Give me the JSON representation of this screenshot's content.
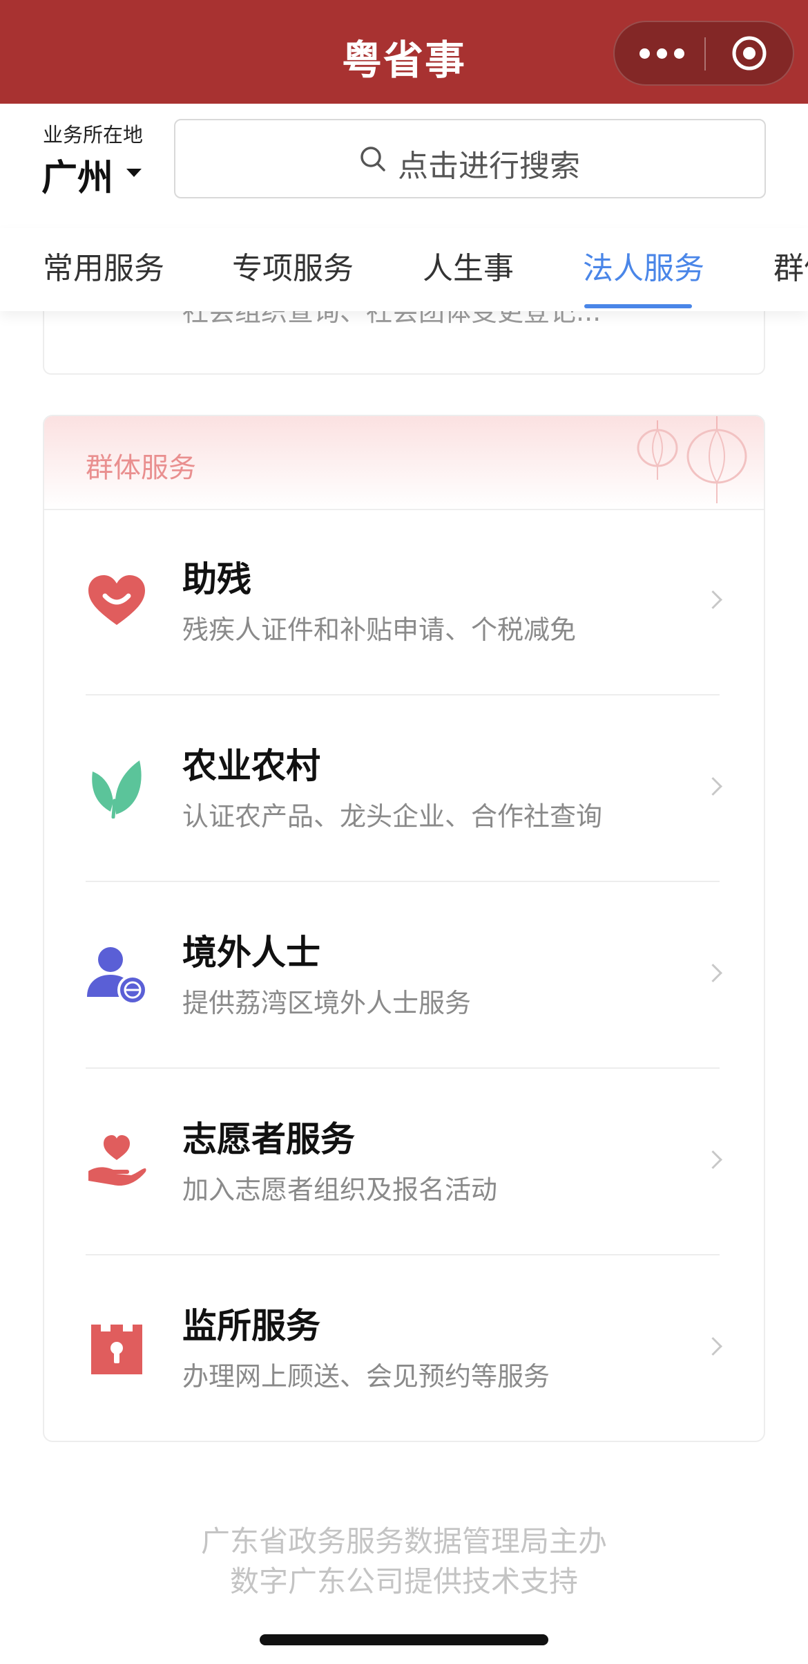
{
  "header": {
    "title": "粤省事",
    "background": "#a83231"
  },
  "location": {
    "label": "业务所在地",
    "city": "广州"
  },
  "search": {
    "placeholder": "点击进行搜索"
  },
  "tabs": [
    {
      "label": "常用服务",
      "active": false
    },
    {
      "label": "专项服务",
      "active": false
    },
    {
      "label": "人生事",
      "active": false
    },
    {
      "label": "法人服务",
      "active": true
    },
    {
      "label": "群体服务",
      "active": false
    }
  ],
  "accent_color": "#4a86e8",
  "previous_card": {
    "description": "社会组织查询、社会团体变更登记..."
  },
  "group_card": {
    "title": "群体服务",
    "items": [
      {
        "title": "助残",
        "description": "残疾人证件和补贴申请、个税减免",
        "icon": "heart-smile-icon",
        "icon_color": "#e05d5d"
      },
      {
        "title": "农业农村",
        "description": "认证农产品、龙头企业、合作社查询",
        "icon": "leaf-icon",
        "icon_color": "#5bc49a"
      },
      {
        "title": "境外人士",
        "description": "提供荔湾区境外人士服务",
        "icon": "person-globe-icon",
        "icon_color": "#5a5fd6"
      },
      {
        "title": "志愿者服务",
        "description": "加入志愿者组织及报名活动",
        "icon": "hand-heart-icon",
        "icon_color": "#e05d5d"
      },
      {
        "title": "监所服务",
        "description": "办理网上顾送、会见预约等服务",
        "icon": "prison-icon",
        "icon_color": "#e05d5d"
      }
    ]
  },
  "footer": {
    "line1": "广东省政务服务数据管理局主办",
    "line2": "数字广东公司提供技术支持"
  }
}
